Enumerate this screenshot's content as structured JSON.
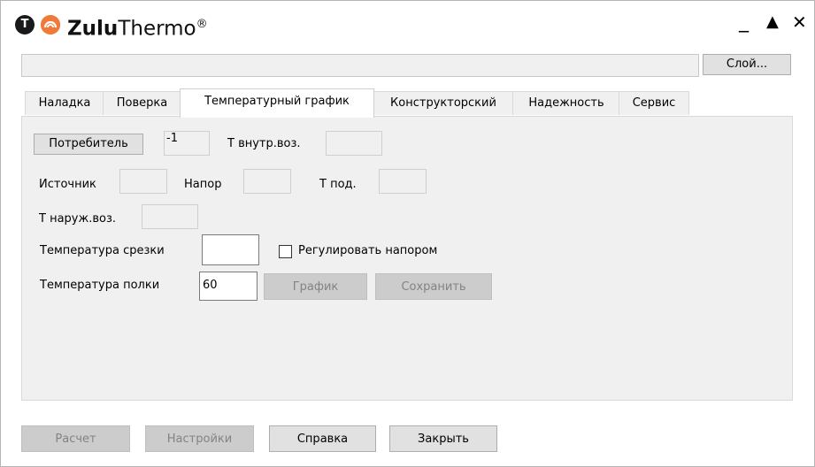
{
  "app": {
    "title_bold": "Zulu",
    "title_regular": "Thermo",
    "title_mark": "®",
    "logo_letter": "T"
  },
  "window_controls": {
    "minimize": "_",
    "maximize": "▲",
    "close": "✕"
  },
  "layer_button": "Слой...",
  "tabs": [
    {
      "label": "Наладка",
      "active": false
    },
    {
      "label": "Поверка",
      "active": false
    },
    {
      "label": "Температурный график",
      "active": true
    },
    {
      "label": "Конструкторский",
      "active": false
    },
    {
      "label": "Надежность",
      "active": false
    },
    {
      "label": "Сервис",
      "active": false
    }
  ],
  "form": {
    "consumer_button": "Потребитель",
    "consumer_value": "-1",
    "t_inner_label": "Т внутр.воз.",
    "t_inner_value": "",
    "source_label": "Источник",
    "source_value": "",
    "head_label": "Напор",
    "head_value": "",
    "t_supply_label": "Т под.",
    "t_supply_value": "",
    "t_outer_label": "Т наруж.воз.",
    "t_outer_value": "",
    "cutoff_label": "Температура срезки",
    "cutoff_value": "",
    "regulate_label": "Регулировать напором",
    "regulate_checked": false,
    "shelf_label": "Температура полки",
    "shelf_value": "60",
    "graph_button": "График",
    "save_button": "Сохранить"
  },
  "footer": {
    "calc_button": "Расчет",
    "settings_button": "Настройки",
    "help_button": "Справка",
    "close_button": "Закрыть"
  },
  "colors": {
    "logo_dark": "#1a1a1a",
    "logo_orange": "#ef7a39",
    "panel_bg": "#f0f0f0",
    "disabled_text": "#838383"
  }
}
